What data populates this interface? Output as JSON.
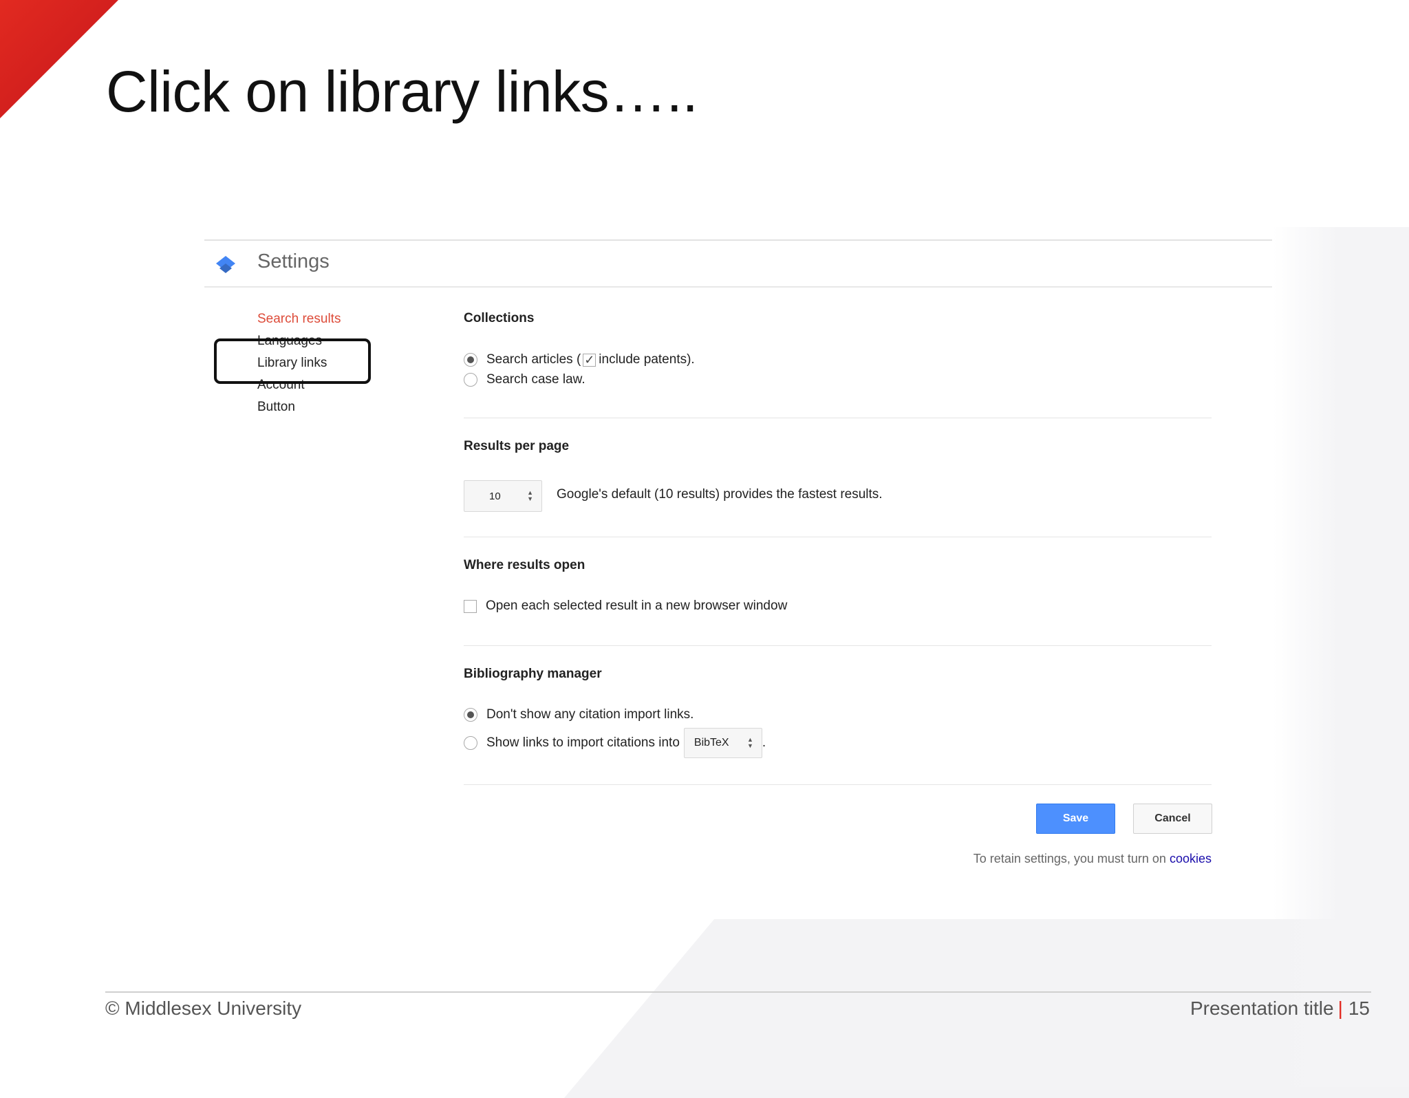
{
  "slide": {
    "title": "Click on library links….."
  },
  "settings": {
    "title": "Settings",
    "nav": [
      {
        "label": "Search results",
        "active": true
      },
      {
        "label": "Languages"
      },
      {
        "label": "Library links",
        "highlighted": true
      },
      {
        "label": "Account"
      },
      {
        "label": "Button"
      }
    ],
    "collections": {
      "title": "Collections",
      "opt_articles_prefix": "Search articles (",
      "opt_articles_suffix": "include patents).",
      "include_patents_checked": true,
      "opt_case_law": "Search case law.",
      "selected": "Search articles"
    },
    "results_per_page": {
      "title": "Results per page",
      "value": "10",
      "hint": "Google's default (10 results) provides the fastest results."
    },
    "where_results_open": {
      "title": "Where results open",
      "option": "Open each selected result in a new browser window",
      "checked": false
    },
    "bibliography": {
      "title": "Bibliography manager",
      "opt_none": "Don't show any citation import links.",
      "opt_show": "Show links to import citations into",
      "format": "BibTeX",
      "suffix": ".",
      "selected": "Don't show any citation import links."
    },
    "buttons": {
      "save": "Save",
      "cancel": "Cancel"
    },
    "retain": {
      "text": "To retain settings, you must turn on",
      "link": "cookies"
    }
  },
  "footer": {
    "copyright": "© Middlesex University",
    "presentation_title": "Presentation title",
    "separator": "|",
    "page_number": "15"
  },
  "colors": {
    "accent_red": "#e2231a",
    "active_nav": "#dd4b39",
    "save_blue": "#4d90fe",
    "link_blue": "#1a0dab"
  }
}
